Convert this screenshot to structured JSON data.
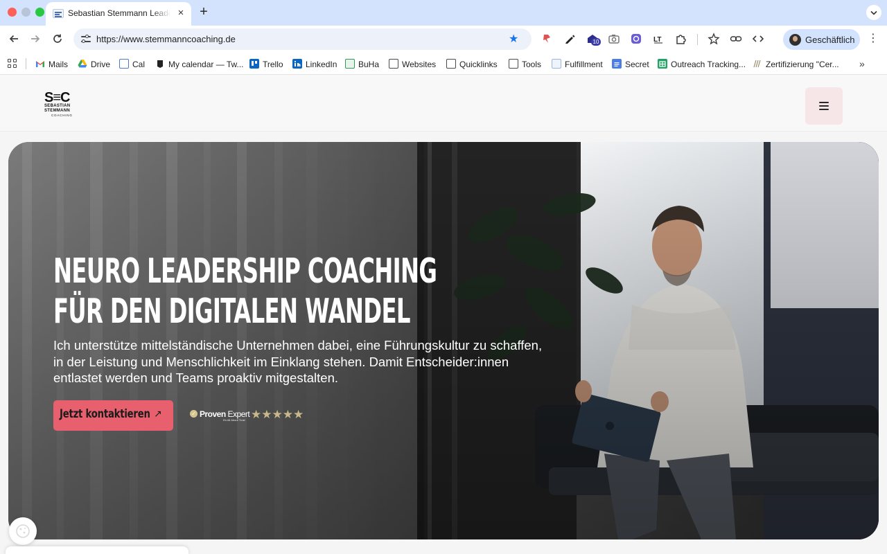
{
  "browser": {
    "tab": {
      "title": "Sebastian Stemmann Leadership Coaching",
      "close": "×"
    },
    "new_tab": "+",
    "url": "https://www.stemmanncoaching.de",
    "extension_badge": "10",
    "profile": {
      "label": "Geschäftlich"
    },
    "bookmarks": [
      {
        "label": "Mails",
        "icon": "gmail-icon"
      },
      {
        "label": "Drive",
        "icon": "google-drive-icon"
      },
      {
        "label": "Cal",
        "icon": "calendar-icon"
      },
      {
        "label": "My calendar — Tw...",
        "icon": "calendar-book-icon"
      },
      {
        "label": "Trello",
        "icon": "trello-icon"
      },
      {
        "label": "LinkedIn",
        "icon": "linkedin-icon"
      },
      {
        "label": "BuHa",
        "icon": "sheet-icon"
      },
      {
        "label": "Websites",
        "icon": "folder-icon"
      },
      {
        "label": "Quicklinks",
        "icon": "folder-icon"
      },
      {
        "label": "Tools",
        "icon": "folder-icon"
      },
      {
        "label": "Fulfillment",
        "icon": "doc-icon"
      },
      {
        "label": "Secret",
        "icon": "google-docs-icon"
      },
      {
        "label": "Outreach Tracking...",
        "icon": "google-sheets-icon"
      },
      {
        "label": "Zertifizierung \"Cer...",
        "icon": "swirl-icon"
      }
    ],
    "bookmarks_more": "»"
  },
  "site": {
    "logo": {
      "mark": "S≡C",
      "line1": "SEBASTIAN",
      "line2": "STEMMANN",
      "line3": "COACHING"
    },
    "hero": {
      "headline_line1": "NEURO LEADERSHIP COACHING",
      "headline_line2": "FÜR DEN DIGITALEN WANDEL",
      "subtext": "Ich unterstütze mittelständische Unternehmen dabei, eine Führungskultur zu schaffen, in der Leistung und Menschlichkeit im Einklang stehen. Damit Entscheider:innen entlastet werden und Teams proaktiv mitgestalten.",
      "cta_label": "Jetzt kontaktieren",
      "cta_arrow": "↗",
      "proven_expert": {
        "name_bold": "Proven",
        "name_light": "Expert",
        "tagline": "It's All About Trust",
        "stars": "★★★★★",
        "rating": 5
      }
    }
  },
  "colors": {
    "tab_strip": "#d3e3fd",
    "accent_star": "#1a73e8",
    "cta": "#e8606e",
    "menu_button": "#f6e6e8"
  }
}
